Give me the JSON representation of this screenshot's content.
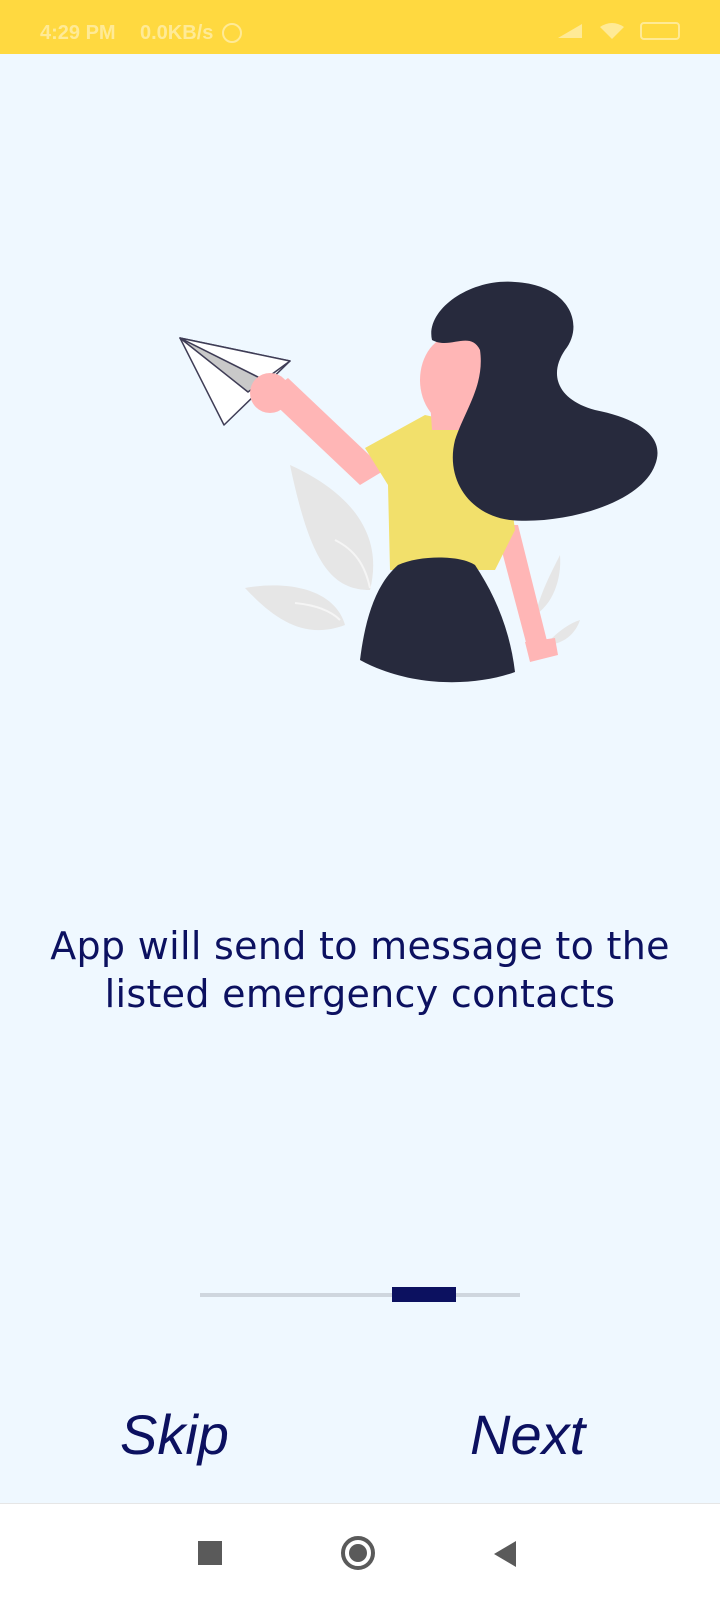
{
  "status_bar": {
    "time": "4:29 PM",
    "speed": "0.0KB/s",
    "icons": [
      "alarm-icon",
      "signal-icon",
      "wifi-icon",
      "battery-icon"
    ]
  },
  "illustration": {
    "name": "woman-throwing-paper-plane",
    "colors": {
      "hair": "#272a3d",
      "skin": "#ffb6b6",
      "shirt": "#f2e06b",
      "skirt": "#272a3d",
      "leaf": "#e6e6e6"
    }
  },
  "onboarding": {
    "message": "App will send to message to the listed emergency contacts",
    "skip_label": "Skip",
    "next_label": "Next"
  },
  "nav_bar": {
    "icons": [
      "recent-apps-icon",
      "home-icon",
      "back-icon"
    ]
  },
  "colors": {
    "status_bar": "#ffd940",
    "background": "#eff8ff",
    "accent": "#0c1160",
    "track": "#cfd6de"
  }
}
